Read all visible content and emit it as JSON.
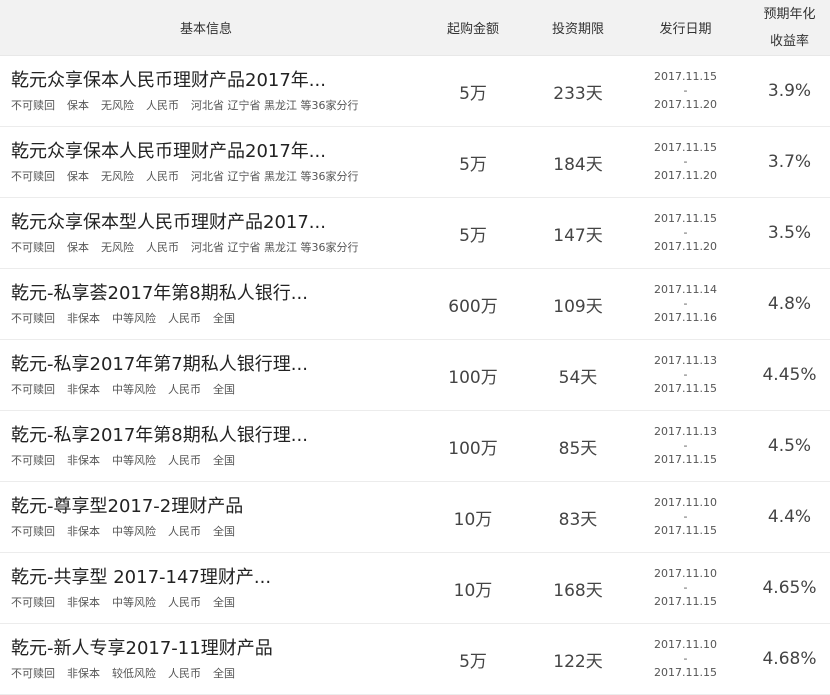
{
  "header": {
    "info": "基本信息",
    "amount": "起购金额",
    "term": "投资期限",
    "date": "发行日期",
    "yield_line1": "预期年化",
    "yield_line2": "收益率"
  },
  "rows": [
    {
      "name": "乾元众享保本人民币理财产品2017年...",
      "tags": [
        "不可赎回",
        "保本",
        "无风险",
        "人民币",
        "河北省 辽宁省 黑龙江 等36家分行"
      ],
      "amount": "5万",
      "term": "233天",
      "date_start": "2017.11.15",
      "date_sep": "-",
      "date_end": "2017.11.20",
      "yield": "3.9%"
    },
    {
      "name": "乾元众享保本人民币理财产品2017年...",
      "tags": [
        "不可赎回",
        "保本",
        "无风险",
        "人民币",
        "河北省 辽宁省 黑龙江 等36家分行"
      ],
      "amount": "5万",
      "term": "184天",
      "date_start": "2017.11.15",
      "date_sep": "-",
      "date_end": "2017.11.20",
      "yield": "3.7%"
    },
    {
      "name": "乾元众享保本型人民币理财产品2017...",
      "tags": [
        "不可赎回",
        "保本",
        "无风险",
        "人民币",
        "河北省 辽宁省 黑龙江 等36家分行"
      ],
      "amount": "5万",
      "term": "147天",
      "date_start": "2017.11.15",
      "date_sep": "-",
      "date_end": "2017.11.20",
      "yield": "3.5%"
    },
    {
      "name": "乾元-私享荟2017年第8期私人银行...",
      "tags": [
        "不可赎回",
        "非保本",
        "中等风险",
        "人民币",
        "全国"
      ],
      "amount": "600万",
      "term": "109天",
      "date_start": "2017.11.14",
      "date_sep": "-",
      "date_end": "2017.11.16",
      "yield": "4.8%"
    },
    {
      "name": "乾元-私享2017年第7期私人银行理...",
      "tags": [
        "不可赎回",
        "非保本",
        "中等风险",
        "人民币",
        "全国"
      ],
      "amount": "100万",
      "term": "54天",
      "date_start": "2017.11.13",
      "date_sep": "-",
      "date_end": "2017.11.15",
      "yield": "4.45%"
    },
    {
      "name": "乾元-私享2017年第8期私人银行理...",
      "tags": [
        "不可赎回",
        "非保本",
        "中等风险",
        "人民币",
        "全国"
      ],
      "amount": "100万",
      "term": "85天",
      "date_start": "2017.11.13",
      "date_sep": "-",
      "date_end": "2017.11.15",
      "yield": "4.5%"
    },
    {
      "name": "乾元-尊享型2017-2理财产品",
      "tags": [
        "不可赎回",
        "非保本",
        "中等风险",
        "人民币",
        "全国"
      ],
      "amount": "10万",
      "term": "83天",
      "date_start": "2017.11.10",
      "date_sep": "-",
      "date_end": "2017.11.15",
      "yield": "4.4%"
    },
    {
      "name": "乾元-共享型 2017-147理财产...",
      "tags": [
        "不可赎回",
        "非保本",
        "中等风险",
        "人民币",
        "全国"
      ],
      "amount": "10万",
      "term": "168天",
      "date_start": "2017.11.10",
      "date_sep": "-",
      "date_end": "2017.11.15",
      "yield": "4.65%"
    },
    {
      "name": "乾元-新人专享2017-11理财产品",
      "tags": [
        "不可赎回",
        "非保本",
        "较低风险",
        "人民币",
        "全国"
      ],
      "amount": "5万",
      "term": "122天",
      "date_start": "2017.11.10",
      "date_sep": "-",
      "date_end": "2017.11.15",
      "yield": "4.68%"
    }
  ]
}
